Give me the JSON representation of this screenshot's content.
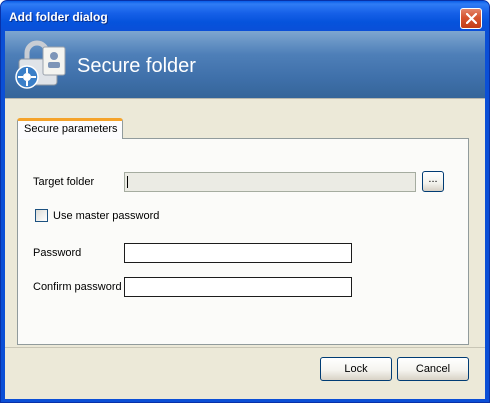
{
  "window": {
    "title": "Add folder dialog",
    "close_icon": "close-icon"
  },
  "banner": {
    "title": "Secure folder",
    "icon": "secure-folder-lock-icon"
  },
  "tabs": [
    {
      "label": "Secure parameters",
      "active": true
    }
  ],
  "form": {
    "target_folder_label": "Target folder",
    "target_folder_value": "",
    "browse_label": "...",
    "master_password_label": "Use master password",
    "master_password_checked": false,
    "password_label": "Password",
    "password_value": "",
    "confirm_password_label": "Confirm password",
    "confirm_password_value": ""
  },
  "buttons": {
    "lock_label": "Lock",
    "cancel_label": "Cancel"
  },
  "colors": {
    "title_bar": "#0a56de",
    "banner": "#4a7bb5",
    "tab_accent": "#f5a32a",
    "dialog_bg": "#ece9d8"
  }
}
